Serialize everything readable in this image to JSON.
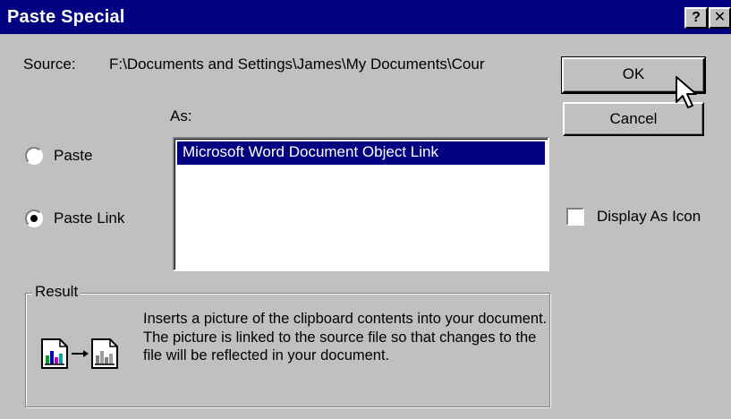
{
  "window": {
    "title": "Paste Special",
    "help_button": "?",
    "close_button": "✕"
  },
  "source": {
    "label": "Source:",
    "path": "F:\\Documents and Settings\\James\\My Documents\\Cour"
  },
  "as_label": "As:",
  "options": {
    "paste": {
      "label": "Paste",
      "selected": false
    },
    "paste_link": {
      "label": "Paste Link",
      "selected": true
    }
  },
  "as_list": {
    "items": [
      "Microsoft Word Document Object Link"
    ],
    "selected_index": 0
  },
  "buttons": {
    "ok": "OK",
    "cancel": "Cancel"
  },
  "display_as_icon": {
    "label": "Display As Icon",
    "checked": false
  },
  "result": {
    "title": "Result",
    "text": "Inserts a picture of the clipboard contents into your document.  The picture is linked to the source file so that changes to the file will be reflected in your document.",
    "icon": "paste-link-picture-icon"
  },
  "colors": {
    "title_bar": "#000080",
    "face": "#c0c0c0",
    "selection": "#000080"
  }
}
